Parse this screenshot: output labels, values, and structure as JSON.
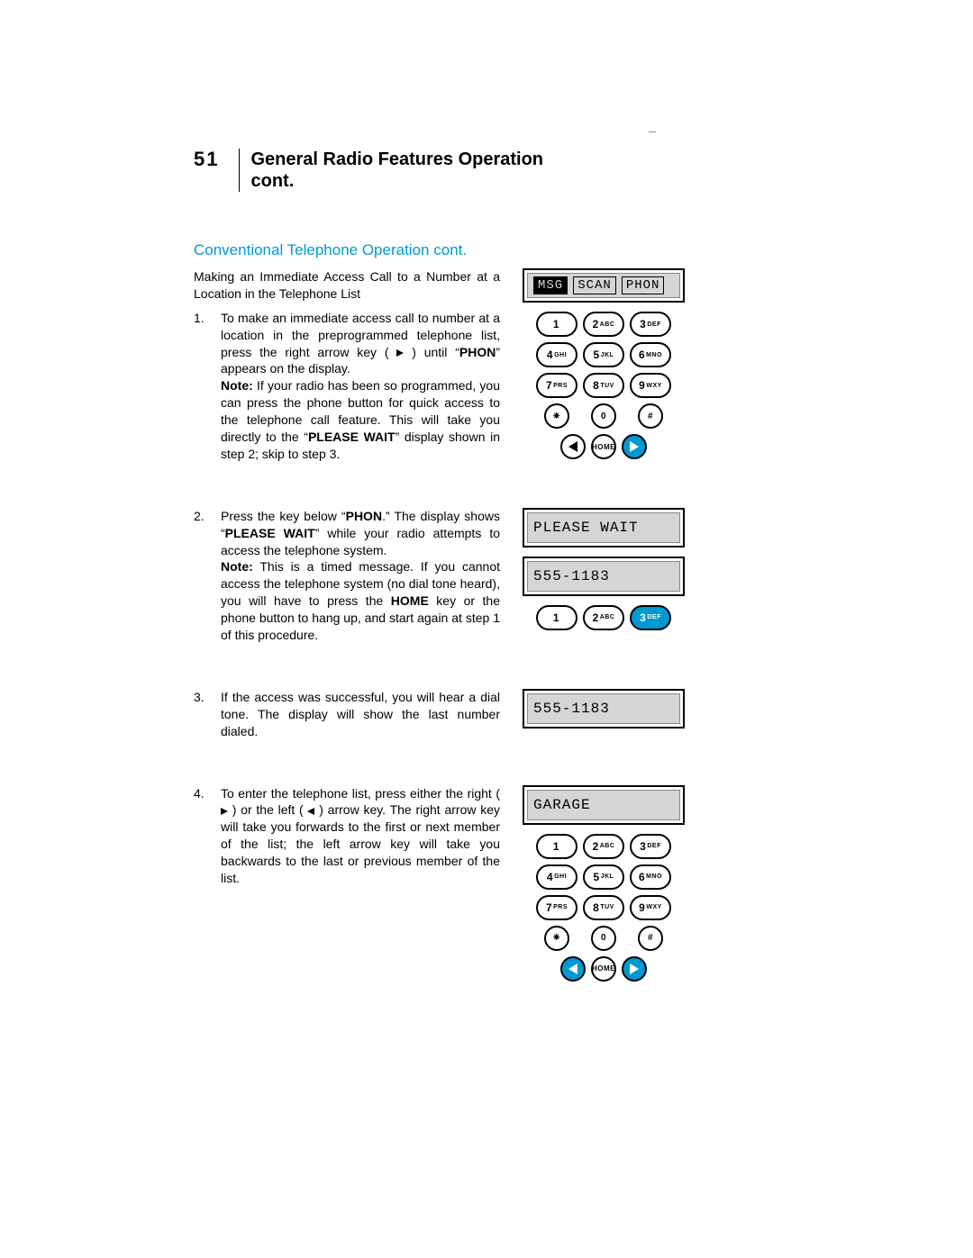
{
  "page_number": "51",
  "title_line1": "General Radio Features Operation",
  "title_line2": "cont.",
  "section_title": "Conventional Telephone Operation cont.",
  "lead": "Making an Immediate Access Call to a Number at a Location in the Telephone List",
  "steps": {
    "s1": {
      "n": "1.",
      "body_a": "To make an immediate access call to number at a location in the preprogrammed telephone list, press the right arrow key (",
      "body_b": ") until “",
      "body_c": "PHON",
      "body_d": "” appears on the display.",
      "note_label": "Note:",
      "note_a": " If your radio has been so programmed, you can press the phone button for quick access to the telephone call feature. This will take you directly to the “",
      "note_b": "PLEASE WAIT",
      "note_c": "” display shown in step 2; skip to step 3."
    },
    "s2": {
      "n": "2.",
      "body_a": "Press the key below “",
      "body_b": "PHON",
      "body_c": ".” The display shows “",
      "body_d": "PLEASE WAIT",
      "body_e": "” while your radio attempts to access the telephone system.",
      "note_label": "Note:",
      "note": " This is a timed message. If you cannot access the telephone system (no dial tone heard), you will have to press the ",
      "note_key": "HOME",
      "note_tail": " key or the phone button to hang up, and start again at step 1 of this procedure."
    },
    "s3": {
      "n": "3.",
      "body": "If the access was successful, you will hear a dial tone. The display will show the last number dialed."
    },
    "s4": {
      "n": "4.",
      "body_a": "To enter the telephone list, press either the right (",
      "body_b": ") or the left (",
      "body_c": ") arrow key. The right arrow key will take you forwards to the first or next member of the list; the left arrow key will take you backwards to the last or previous member of the list."
    }
  },
  "lcd": {
    "a1": "MSG",
    "a2": "SCAN",
    "a3": "PHON",
    "please_wait": "PLEASE WAIT",
    "num": "555-1183",
    "garage": "GARAGE"
  },
  "keys": {
    "k1": "1",
    "k2n": "2",
    "k2l": "ABC",
    "k3n": "3",
    "k3l": "DEF",
    "k4n": "4",
    "k4l": "GHI",
    "k5n": "5",
    "k5l": "JKL",
    "k6n": "6",
    "k6l": "MNO",
    "k7n": "7",
    "k7l": "PRS",
    "k8n": "8",
    "k8l": "TUV",
    "k9n": "9",
    "k9l": "WXY",
    "star": "✷",
    "k0": "0",
    "hash": "#",
    "home": "HOME"
  }
}
